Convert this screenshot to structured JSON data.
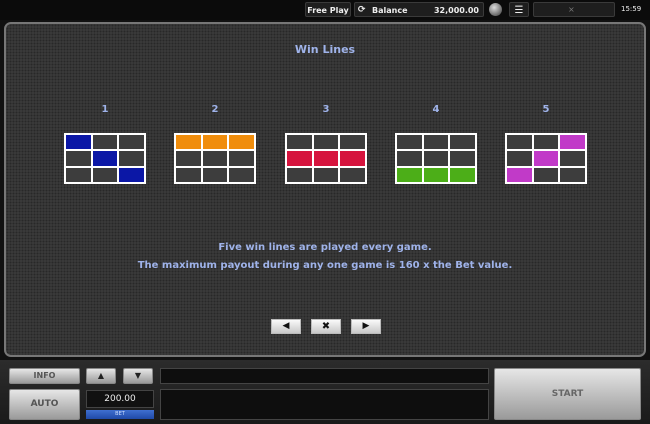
{
  "topbar": {
    "free_play": "Free Play",
    "balance_icon": "refresh-icon",
    "balance_label": "Balance",
    "balance_value": "32,000.00",
    "sound_icon": "sound-icon",
    "menu_icon": "☰",
    "close_icon": "×",
    "clock": "15:59"
  },
  "panel": {
    "title": "Win Lines",
    "lines": [
      {
        "number": "1",
        "color": "#0b17a6",
        "cells": [
          [
            1,
            0,
            0
          ],
          [
            0,
            1,
            0
          ],
          [
            0,
            0,
            1
          ]
        ]
      },
      {
        "number": "2",
        "color": "#f08d0c",
        "cells": [
          [
            1,
            1,
            1
          ],
          [
            0,
            0,
            0
          ],
          [
            0,
            0,
            0
          ]
        ]
      },
      {
        "number": "3",
        "color": "#d6143e",
        "cells": [
          [
            0,
            0,
            0
          ],
          [
            1,
            1,
            1
          ],
          [
            0,
            0,
            0
          ]
        ]
      },
      {
        "number": "4",
        "color": "#4cae18",
        "cells": [
          [
            0,
            0,
            0
          ],
          [
            0,
            0,
            0
          ],
          [
            1,
            1,
            1
          ]
        ]
      },
      {
        "number": "5",
        "color": "#c13ac8",
        "cells": [
          [
            0,
            0,
            1
          ],
          [
            0,
            1,
            0
          ],
          [
            1,
            0,
            0
          ]
        ]
      }
    ],
    "description_line1": "Five win lines are played every game.",
    "description_line2": "The maximum payout during any one game is 160 x the Bet value.",
    "nav": {
      "prev": "◀",
      "close": "✖",
      "next": "▶"
    }
  },
  "bottombar": {
    "info_label": "INFO",
    "auto_label": "AUTO",
    "up_label": "▲",
    "down_label": "▼",
    "bet_value": "200.00",
    "bet_label": "BET",
    "start_label": "START"
  }
}
